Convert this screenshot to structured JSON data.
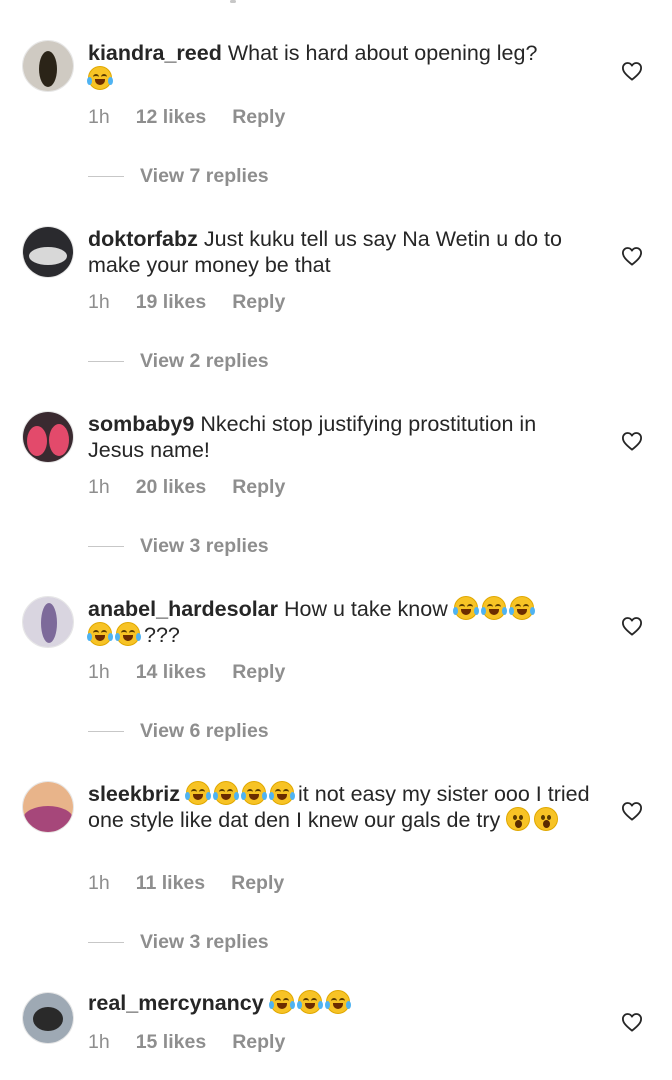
{
  "comments": [
    {
      "username": "kiandra_reed",
      "text": "What is hard about opening leg?",
      "emoji_after": "laughing-tears",
      "time": "1h",
      "likes": "12 likes",
      "reply": "Reply",
      "view_replies": "View 7 replies",
      "avatar_colors": [
        "#cfcac2",
        "#2b2418"
      ]
    },
    {
      "username": "doktorfabz",
      "text": "Just kuku tell us say Na Wetin u do to make your money be that",
      "time": "1h",
      "likes": "19 likes",
      "reply": "Reply",
      "view_replies": "View 2 replies",
      "avatar_colors": [
        "#2a2a2e",
        "#d8d8d8"
      ]
    },
    {
      "username": "sombaby9",
      "text": "Nkechi stop justifying prostitution in Jesus name!",
      "time": "1h",
      "likes": "20 likes",
      "reply": "Reply",
      "view_replies": "View 3 replies",
      "avatar_colors": [
        "#e34a6b",
        "#3a2a30"
      ]
    },
    {
      "username": "anabel_hardesolar",
      "text": "How u take know",
      "emoji_mid_count": 5,
      "text_after": "???",
      "time": "1h",
      "likes": "14 likes",
      "reply": "Reply",
      "view_replies": "View 6 replies",
      "avatar_colors": [
        "#d9d5e0",
        "#7d6a9a"
      ]
    },
    {
      "username": "sleekbriz",
      "emoji_before_count": 4,
      "text": "it not easy my sister ooo I tried one style like dat den I knew our gals de try",
      "emoji_wow_count": 2,
      "time": "1h",
      "likes": "11 likes",
      "reply": "Reply",
      "view_replies": "View 3 replies",
      "avatar_colors": [
        "#a6477a",
        "#e8b48a"
      ]
    },
    {
      "username": "real_mercynancy",
      "emoji_after_count": 3,
      "time": "1h",
      "likes": "15 likes",
      "reply": "Reply",
      "avatar_colors": [
        "#9ea9b4",
        "#2a2a2a"
      ]
    }
  ],
  "icons": {
    "like": "heart-outline-icon",
    "emoji_laugh": "face-with-tears-of-joy-icon",
    "emoji_wow": "face-with-open-mouth-icon"
  },
  "colors": {
    "text": "#262626",
    "muted": "#8e8e8e",
    "divider": "#c7c7c7"
  }
}
